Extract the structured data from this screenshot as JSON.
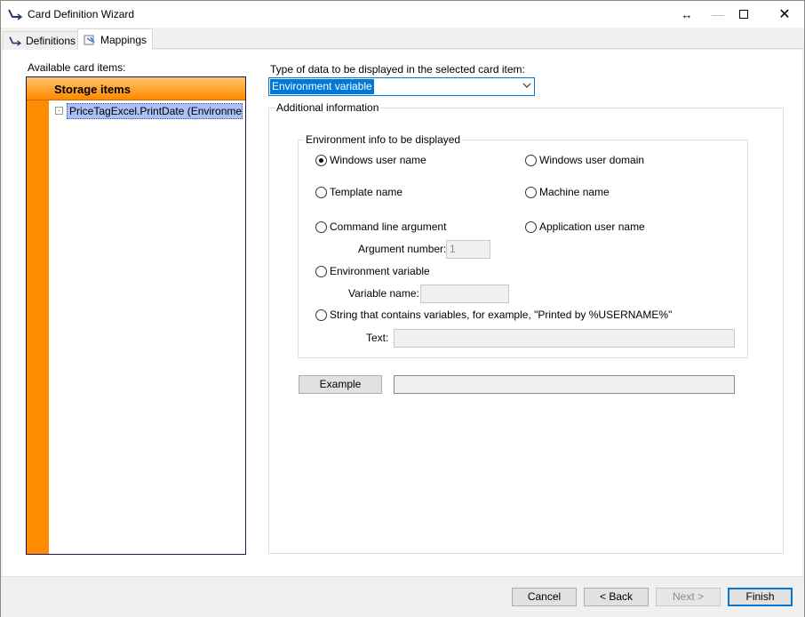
{
  "window": {
    "title": "Card Definition Wizard"
  },
  "tabs": [
    {
      "label": "Definitions",
      "icon": "wizard-arrow-icon"
    },
    {
      "label": "Mappings",
      "icon": "mapping-icon"
    }
  ],
  "left": {
    "label": "Available card items:",
    "header": "Storage items",
    "item": "PriceTagExcel.PrintDate (Environme..."
  },
  "right": {
    "type_label": "Type of data to be displayed in the selected card item:",
    "type_value": "Environment variable",
    "additional_title": "Additional information",
    "env_title": "Environment info to be displayed",
    "options": {
      "windows_user_name": "Windows user name",
      "windows_user_domain": "Windows user domain",
      "template_name": "Template name",
      "machine_name": "Machine name",
      "command_line_argument": "Command line argument",
      "application_user_name": "Application user name",
      "environment_variable": "Environment variable",
      "string_with_variables": "String that contains variables, for example, \"Printed by %USERNAME%\""
    },
    "selected": "windows_user_name",
    "argument_label": "Argument number:",
    "argument_value": "1",
    "variable_label": "Variable name:",
    "variable_value": "",
    "text_label": "Text:",
    "text_value": "",
    "example_button": "Example",
    "example_value": ""
  },
  "footer": {
    "cancel": "Cancel",
    "back": "< Back",
    "next": "Next >",
    "finish": "Finish"
  }
}
